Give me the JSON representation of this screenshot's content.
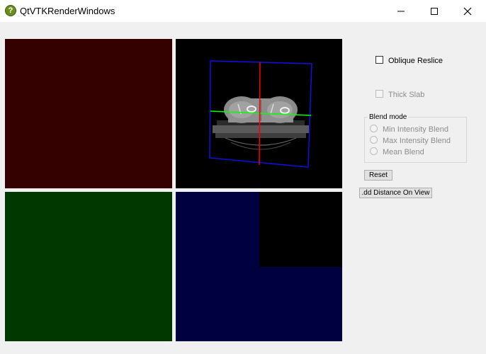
{
  "window": {
    "title": "QtVTKRenderWindows",
    "icon": "app-question-icon",
    "icon_glyph": "?"
  },
  "viewports": {
    "top_left_color": "#350000",
    "top_right_color": "#000000",
    "bottom_left_color": "#003800",
    "bottom_right_color": "#000040"
  },
  "controls": {
    "oblique_reslice_label": "Oblique Reslice",
    "thick_slab_label": "Thick Slab",
    "blend_mode_title": "Blend mode",
    "blend_options": [
      "Min Intensity Blend",
      "Max Intensity Blend",
      "Mean Blend"
    ],
    "reset_label": "Reset",
    "add_distance_label": ".dd Distance On View"
  },
  "colors": {
    "cursor_red": "#ff0000",
    "cursor_green": "#00ff00",
    "bounds_blue": "#1010e0"
  }
}
